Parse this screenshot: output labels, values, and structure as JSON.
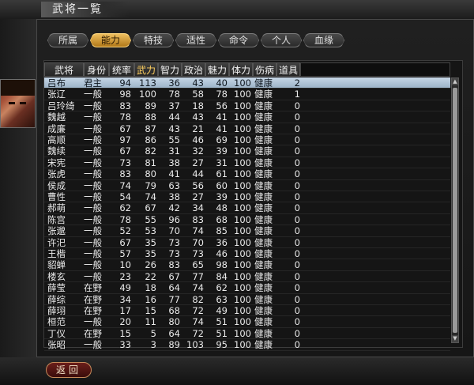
{
  "window": {
    "title": "武将一覧"
  },
  "tabs": [
    {
      "label": "所属",
      "active": false
    },
    {
      "label": "能力",
      "active": true
    },
    {
      "label": "特技",
      "active": false
    },
    {
      "label": "适性",
      "active": false
    },
    {
      "label": "命令",
      "active": false
    },
    {
      "label": "个人",
      "active": false
    },
    {
      "label": "血缘",
      "active": false
    }
  ],
  "table": {
    "columns": [
      "武将",
      "身份",
      "统率",
      "武力",
      "智力",
      "政治",
      "魅力",
      "体力",
      "伤病",
      "道具"
    ],
    "sorted_column": "武力",
    "rows": [
      [
        "吕布",
        "君主",
        "94",
        "113",
        "36",
        "43",
        "40",
        "100",
        "健康",
        "2"
      ],
      [
        "张辽",
        "一般",
        "98",
        "100",
        "78",
        "58",
        "78",
        "100",
        "健康",
        "1"
      ],
      [
        "吕玲绮",
        "一般",
        "83",
        "89",
        "37",
        "18",
        "56",
        "100",
        "健康",
        "0"
      ],
      [
        "魏越",
        "一般",
        "78",
        "88",
        "44",
        "43",
        "41",
        "100",
        "健康",
        "0"
      ],
      [
        "成廉",
        "一般",
        "67",
        "87",
        "43",
        "21",
        "41",
        "100",
        "健康",
        "0"
      ],
      [
        "高顺",
        "一般",
        "97",
        "86",
        "55",
        "46",
        "69",
        "100",
        "健康",
        "0"
      ],
      [
        "魏续",
        "一般",
        "67",
        "82",
        "31",
        "32",
        "39",
        "100",
        "健康",
        "0"
      ],
      [
        "宋宪",
        "一般",
        "73",
        "81",
        "38",
        "27",
        "31",
        "100",
        "健康",
        "0"
      ],
      [
        "张虎",
        "一般",
        "83",
        "80",
        "41",
        "44",
        "61",
        "100",
        "健康",
        "0"
      ],
      [
        "侯成",
        "一般",
        "74",
        "79",
        "63",
        "56",
        "60",
        "100",
        "健康",
        "0"
      ],
      [
        "曹性",
        "一般",
        "54",
        "74",
        "38",
        "27",
        "39",
        "100",
        "健康",
        "0"
      ],
      [
        "郝萌",
        "一般",
        "62",
        "67",
        "42",
        "34",
        "48",
        "100",
        "健康",
        "0"
      ],
      [
        "陈宫",
        "一般",
        "78",
        "55",
        "96",
        "83",
        "68",
        "100",
        "健康",
        "0"
      ],
      [
        "张邈",
        "一般",
        "52",
        "53",
        "70",
        "74",
        "85",
        "100",
        "健康",
        "0"
      ],
      [
        "许汜",
        "一般",
        "67",
        "35",
        "73",
        "70",
        "36",
        "100",
        "健康",
        "0"
      ],
      [
        "王楷",
        "一般",
        "57",
        "35",
        "73",
        "73",
        "46",
        "100",
        "健康",
        "0"
      ],
      [
        "貂蝉",
        "一般",
        "10",
        "26",
        "83",
        "65",
        "98",
        "100",
        "健康",
        "0"
      ],
      [
        "楼玄",
        "一般",
        "23",
        "22",
        "67",
        "77",
        "84",
        "100",
        "健康",
        "0"
      ],
      [
        "薛莹",
        "在野",
        "49",
        "18",
        "64",
        "74",
        "62",
        "100",
        "健康",
        "0"
      ],
      [
        "薛综",
        "在野",
        "34",
        "16",
        "77",
        "82",
        "63",
        "100",
        "健康",
        "0"
      ],
      [
        "薛珝",
        "在野",
        "17",
        "15",
        "68",
        "72",
        "49",
        "100",
        "健康",
        "0"
      ],
      [
        "桓范",
        "一般",
        "20",
        "11",
        "80",
        "74",
        "51",
        "100",
        "健康",
        "0"
      ],
      [
        "丁仪",
        "在野",
        "15",
        "5",
        "64",
        "72",
        "51",
        "100",
        "健康",
        "0"
      ],
      [
        "张昭",
        "一般",
        "33",
        "3",
        "89",
        "103",
        "95",
        "100",
        "健康",
        "0"
      ]
    ],
    "selected_row": 0
  },
  "footer": {
    "back_label": "返回"
  },
  "colors": {
    "accent": "#e0a840",
    "selection": "#b4c8dc",
    "back_button": "#5a1814"
  },
  "icons": [
    "portrait-lubu",
    "scroll-up-arrow-icon",
    "scroll-down-arrow-icon"
  ]
}
